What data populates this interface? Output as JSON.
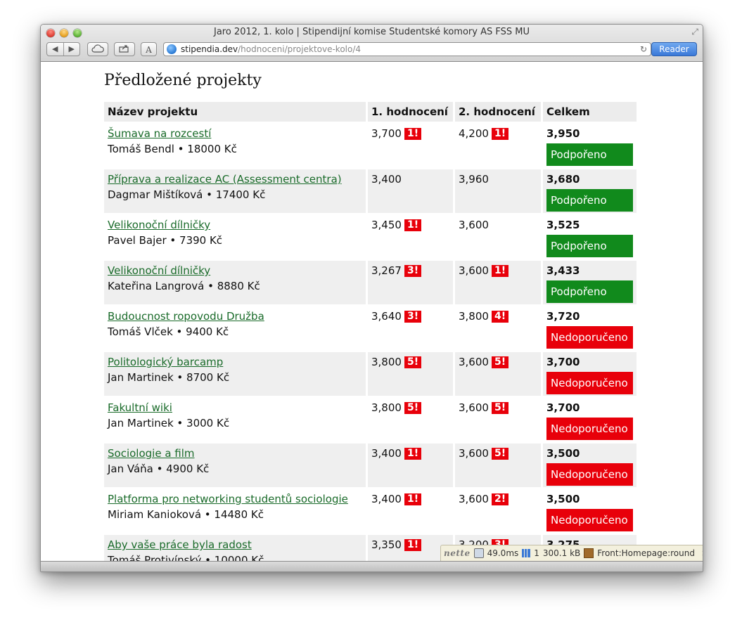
{
  "window": {
    "title": "Jaro 2012, 1. kolo | Stipendijní komise Studentské komory AS FSS MU",
    "address_domain": "stipendia.dev",
    "address_path": "/hodnoceni/projektove-kolo/4",
    "reader_label": "Reader"
  },
  "page": {
    "title": "Předložené projekty"
  },
  "table": {
    "headers": [
      "Název projektu",
      "1. hodnocení",
      "2. hodnocení",
      "Celkem"
    ],
    "rows": [
      {
        "name": "Šumava na rozcestí",
        "meta": "Tomáš Bendl • 18000 Kč",
        "s1": "3,700",
        "w1": "1!",
        "s2": "4,200",
        "w2": "1!",
        "total": "3,950",
        "status": "Podpořeno"
      },
      {
        "name": "Příprava a realizace AC (Assessment centra)",
        "meta": "Dagmar Mištíková • 17400 Kč",
        "s1": "3,400",
        "w1": "",
        "s2": "3,960",
        "w2": "",
        "total": "3,680",
        "status": "Podpořeno"
      },
      {
        "name": "Velikonoční dílničky",
        "meta": "Pavel Bajer • 7390 Kč",
        "s1": "3,450",
        "w1": "1!",
        "s2": "3,600",
        "w2": "",
        "total": "3,525",
        "status": "Podpořeno"
      },
      {
        "name": "Velikonoční dílničky",
        "meta": "Kateřina Langrová • 8880 Kč",
        "s1": "3,267",
        "w1": "3!",
        "s2": "3,600",
        "w2": "1!",
        "total": "3,433",
        "status": "Podpořeno"
      },
      {
        "name": "Budoucnost ropovodu Družba",
        "meta": "Tomáš Vlček • 9400 Kč",
        "s1": "3,640",
        "w1": "3!",
        "s2": "3,800",
        "w2": "4!",
        "total": "3,720",
        "status": "Nedoporučeno"
      },
      {
        "name": "Politologický barcamp",
        "meta": "Jan Martinek • 8700 Kč",
        "s1": "3,800",
        "w1": "5!",
        "s2": "3,600",
        "w2": "5!",
        "total": "3,700",
        "status": "Nedoporučeno"
      },
      {
        "name": "Fakultní wiki",
        "meta": "Jan Martinek • 3000 Kč",
        "s1": "3,800",
        "w1": "5!",
        "s2": "3,600",
        "w2": "5!",
        "total": "3,700",
        "status": "Nedoporučeno"
      },
      {
        "name": "Sociologie a film",
        "meta": "Jan Váňa • 4900 Kč",
        "s1": "3,400",
        "w1": "1!",
        "s2": "3,600",
        "w2": "5!",
        "total": "3,500",
        "status": "Nedoporučeno"
      },
      {
        "name": "Platforma pro networking studentů sociologie",
        "meta": "Miriam Kanioková • 14480 Kč",
        "s1": "3,400",
        "w1": "1!",
        "s2": "3,600",
        "w2": "2!",
        "total": "3,500",
        "status": "Nedoporučeno"
      },
      {
        "name": "Aby vaše práce byla radost",
        "meta": "Tomáš Protivínský • 10000 Kč",
        "s1": "3,350",
        "w1": "1!",
        "s2": "3,200",
        "w2": "3!",
        "total": "3,275",
        "status": ""
      }
    ]
  },
  "debug_bar": {
    "logo": "nette",
    "time": "49.0ms",
    "queries": "1",
    "memory": "300.1 kB",
    "route": "Front:Homepage:round",
    "close": "×"
  },
  "colors": {
    "link": "#1a6b2a",
    "supported": "#118a1c",
    "not_recommended": "#e8000a",
    "warning_badge": "#e8000a",
    "row_alt": "#efefef",
    "reader": "#3a78d8"
  }
}
